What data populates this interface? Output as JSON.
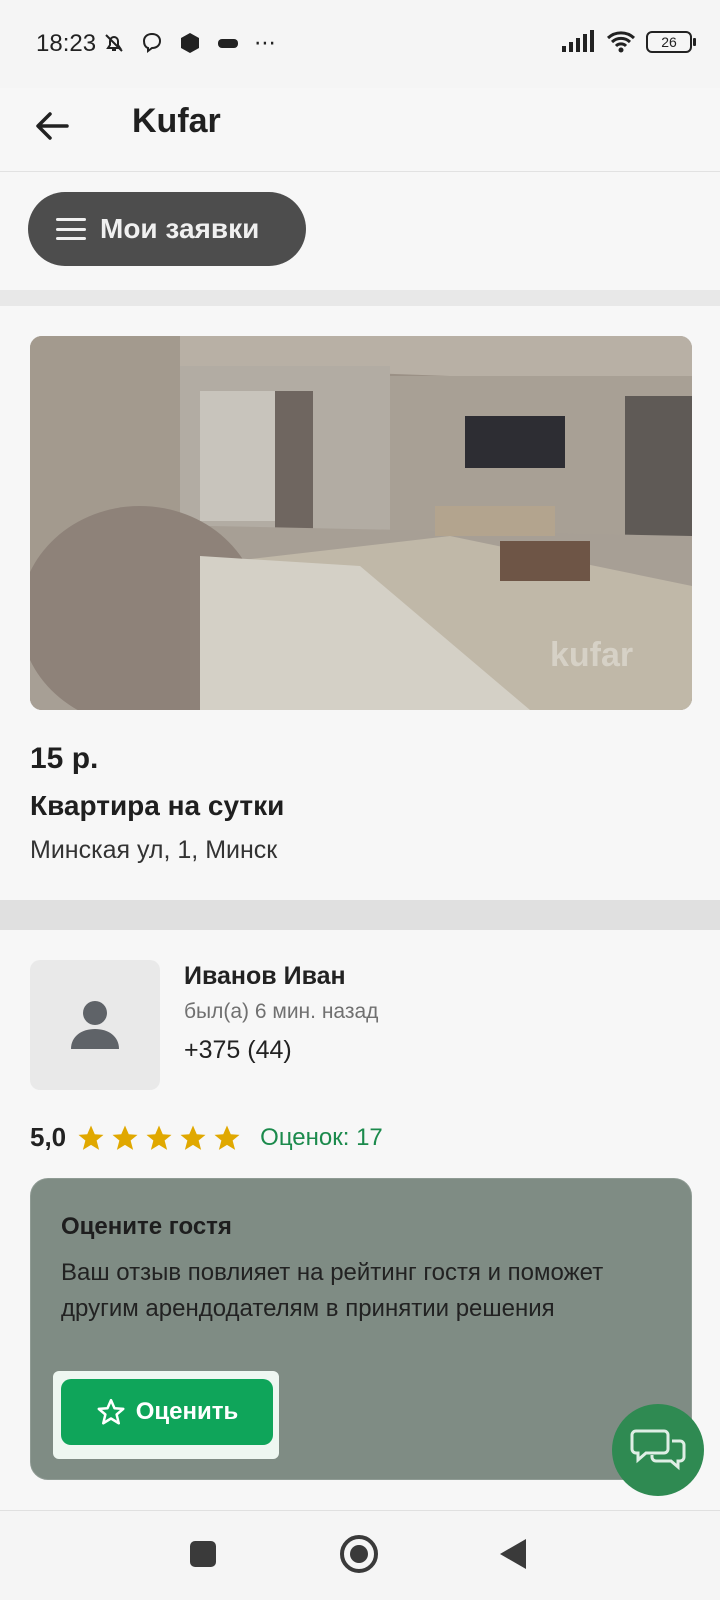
{
  "status": {
    "time": "18:23",
    "battery": "26"
  },
  "appbar": {
    "title": "Kufar"
  },
  "requests": {
    "label": "Мои заявки"
  },
  "listing": {
    "price": "15 р.",
    "title": "Квартира на сутки",
    "address": "Минская ул, 1, Минск",
    "watermark": "kufar"
  },
  "guest": {
    "name": "Иванов Иван",
    "last_seen": "был(а) 6 мин. назад",
    "phone": "+375 (44)",
    "rating": "5,0",
    "stars": 5,
    "reviews": "Оценок: 17"
  },
  "rate_card": {
    "title": "Оцените гостя",
    "text": "Ваш отзыв повлияет на рейтинг гостя и поможет другим арендодателям в принятии решения",
    "button": "Оценить"
  },
  "colors": {
    "accent": "#0fa55a",
    "star": "#e0a800",
    "link": "#1b8a4c"
  }
}
